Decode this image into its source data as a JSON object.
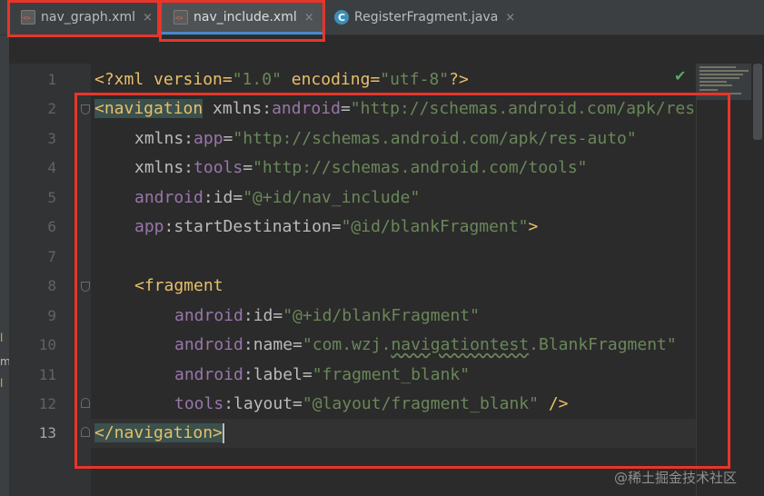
{
  "tabs": [
    {
      "label": "nav_graph.xml",
      "icon": "xml-file-icon",
      "close": "×"
    },
    {
      "label": "nav_include.xml",
      "icon": "xml-file-icon",
      "close": "×",
      "active": true
    },
    {
      "label": "RegisterFragment.java",
      "icon": "java-class-icon",
      "icon_glyph": "C",
      "close": "×"
    }
  ],
  "left_strip_fragments": [
    "l",
    "m",
    "l"
  ],
  "line_numbers": [
    "1",
    "2",
    "3",
    "4",
    "5",
    "6",
    "7",
    "8",
    "9",
    "10",
    "11",
    "12",
    "13"
  ],
  "current_line": "13",
  "code": {
    "l1": {
      "a": "<?xml version=",
      "b": "\"1.0\"",
      "c": " encoding=",
      "d": "\"utf-8\"",
      "e": "?>"
    },
    "l2": {
      "a": "<navigation",
      "b": " xmlns:",
      "c": "android",
      "d": "=",
      "e": "\"http://schemas.android.com/apk/res/android\""
    },
    "l3": {
      "a": "xmlns:",
      "b": "app",
      "c": "=",
      "d": "\"http://schemas.android.com/apk/res-auto\""
    },
    "l4": {
      "a": "xmlns:",
      "b": "tools",
      "c": "=",
      "d": "\"http://schemas.android.com/tools\""
    },
    "l5": {
      "a": "android",
      "b": ":id=",
      "c": "\"@+id/nav_include\""
    },
    "l6": {
      "a": "app",
      "b": ":startDestination=",
      "c": "\"@id/blankFragment\"",
      "d": ">"
    },
    "l8": {
      "a": "<fragment"
    },
    "l9": {
      "a": "android",
      "b": ":id=",
      "c": "\"@+id/blankFragment\""
    },
    "l10": {
      "a": "android",
      "b": ":name=",
      "c": "\"com.wzj.",
      "d": "navigationtest",
      "e": ".BlankFragment\""
    },
    "l11": {
      "a": "android",
      "b": ":label=",
      "c": "\"fragment_blank\""
    },
    "l12": {
      "a": "tools",
      "b": ":layout=",
      "c": "\"@layout/fragment_blank\"",
      "d": " />"
    },
    "l13": {
      "a": "</navigation>"
    }
  },
  "status_icon": "check-icon",
  "status_glyph": "✔",
  "watermark": "@稀土掘金技术社区",
  "colors": {
    "annotation_red": "#e8352a",
    "tag": "#e8bf6a",
    "namespace": "#9876aa",
    "string": "#6a8759",
    "active_tab_underline": "#4a88c7"
  }
}
